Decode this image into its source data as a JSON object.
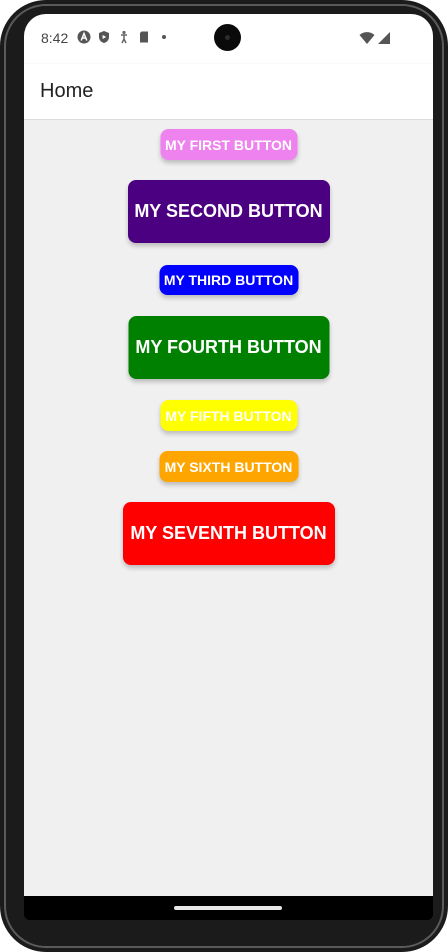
{
  "status_bar": {
    "time": "8:42",
    "icons_left": [
      "a-badge-icon",
      "shield-play-icon",
      "accessibility-icon",
      "sd-card-icon",
      "dot-icon"
    ],
    "icons_right": [
      "wifi-icon",
      "cell-signal-icon"
    ]
  },
  "app_bar": {
    "title": "Home"
  },
  "buttons": [
    {
      "label": "MY FIRST BUTTON",
      "color": "#ee82ee"
    },
    {
      "label": "MY SECOND BUTTON",
      "color": "#4b0082"
    },
    {
      "label": "MY THIRD BUTTON",
      "color": "#0000ff"
    },
    {
      "label": "MY FOURTH BUTTON",
      "color": "#008000"
    },
    {
      "label": "MY FIFTH BUTTON",
      "color": "#ffff00"
    },
    {
      "label": "MY SIXTH BUTTON",
      "color": "#ffa500"
    },
    {
      "label": "MY SEVENTH BUTTON",
      "color": "#ff0000"
    }
  ]
}
